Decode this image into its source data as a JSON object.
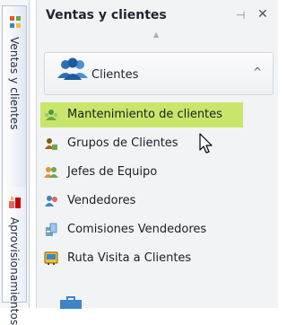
{
  "left_tabs": [
    {
      "label": "Ventas y clientes",
      "icon": "people-tree-icon"
    },
    {
      "label": "Aprovisionamientos",
      "icon": "supply-icon"
    }
  ],
  "panel": {
    "title": "Ventas y clientes",
    "pin_glyph": "⊣",
    "close_glyph": "✕",
    "collapse_caret": "▲"
  },
  "group": {
    "label": "Clientes",
    "icon": "clients-group-icon",
    "caret": "^"
  },
  "items": [
    {
      "label": "Mantenimiento de clientes",
      "icon": "customer-maintenance-icon",
      "selected": true
    },
    {
      "label": "Grupos de Clientes",
      "icon": "customer-groups-icon",
      "selected": false
    },
    {
      "label": "Jefes de Equipo",
      "icon": "team-leaders-icon",
      "selected": false
    },
    {
      "label": "Vendedores",
      "icon": "salespeople-icon",
      "selected": false
    },
    {
      "label": "Comisiones Vendedores",
      "icon": "commissions-icon",
      "selected": false
    },
    {
      "label": "Ruta Visita a Clientes",
      "icon": "visit-route-icon",
      "selected": false
    }
  ],
  "colors": {
    "selected_bg": "#c8e66a",
    "panel_bg": "#f2f3f5",
    "text": "#1b1f25"
  }
}
